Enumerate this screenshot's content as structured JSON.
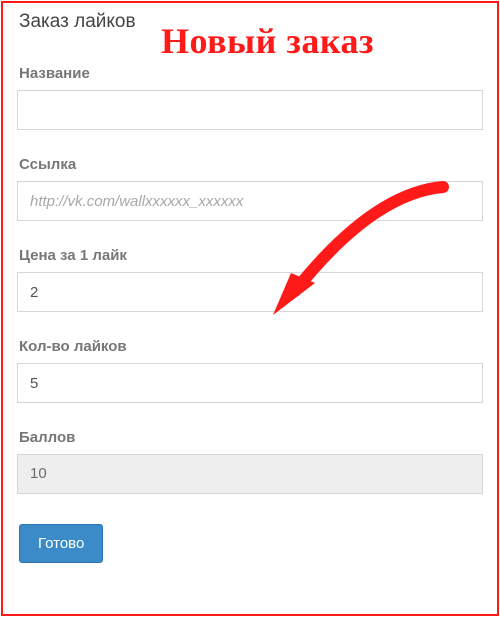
{
  "title": "Заказ лайков",
  "overlay": "Новый заказ",
  "fields": {
    "name": {
      "label": "Название",
      "value": ""
    },
    "link": {
      "label": "Ссылка",
      "placeholder": "http://vk.com/wallxxxxxx_xxxxxx",
      "value": ""
    },
    "price": {
      "label": "Цена за 1 лайк",
      "value": "2"
    },
    "qty": {
      "label": "Кол-во лайков",
      "value": "5"
    },
    "points": {
      "label": "Баллов",
      "value": "10"
    }
  },
  "submit_label": "Готово",
  "annotation": {
    "arrow_color": "#ff1a1a"
  }
}
